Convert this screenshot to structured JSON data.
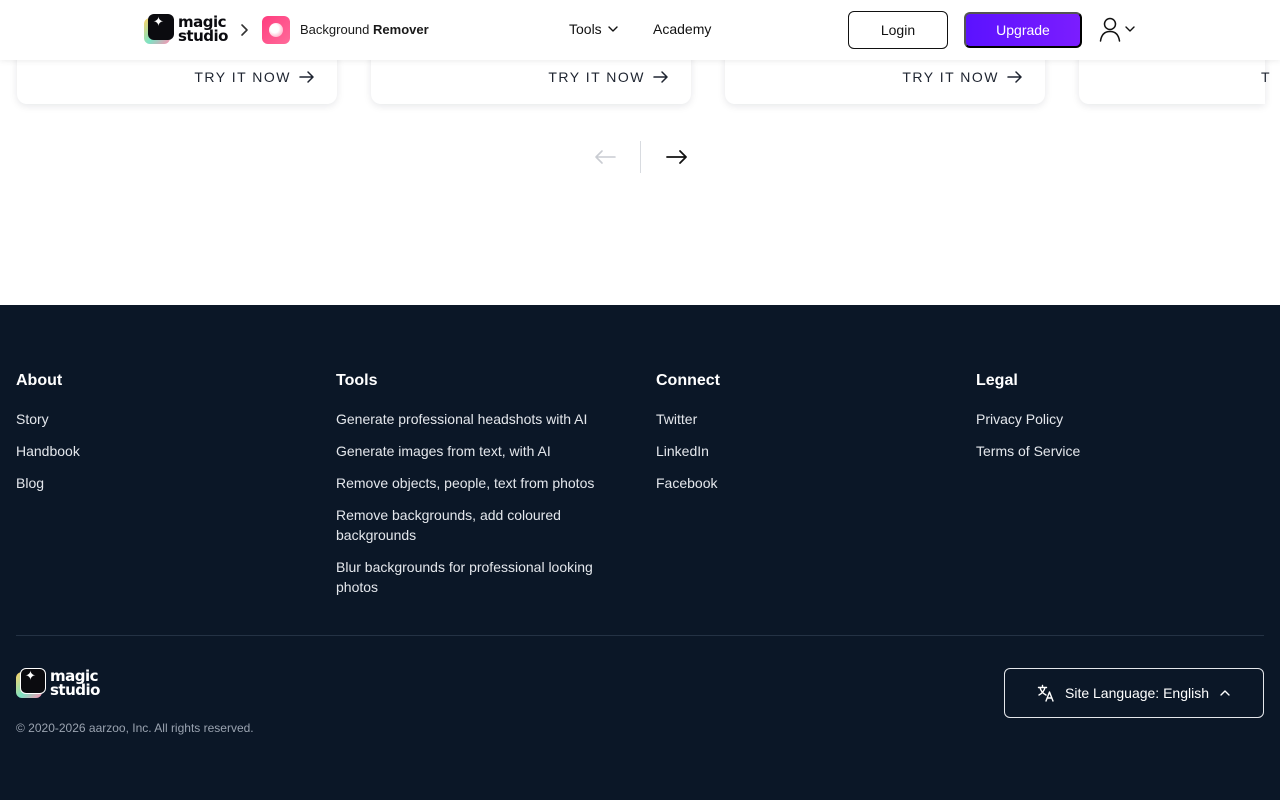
{
  "header": {
    "brand_line1": "magic",
    "brand_line2": "studio",
    "product_name_light": "Background",
    "product_name_bold": "Remover",
    "nav": {
      "tools": "Tools",
      "academy": "Academy"
    },
    "login": "Login",
    "upgrade": "Upgrade"
  },
  "cards": [
    {
      "cta": "TRY IT NOW"
    },
    {
      "cta": "TRY IT NOW"
    },
    {
      "cta": "TRY IT NOW"
    },
    {
      "cta": "T"
    }
  ],
  "footer": {
    "about": {
      "title": "About",
      "items": [
        "Story",
        "Handbook",
        "Blog"
      ]
    },
    "tools": {
      "title": "Tools",
      "items": [
        "Generate professional headshots with AI",
        "Generate images from text, with AI",
        "Remove objects, people, text from photos",
        "Remove backgrounds, add coloured backgrounds",
        "Blur backgrounds for professional looking photos"
      ]
    },
    "connect": {
      "title": "Connect",
      "items": [
        "Twitter",
        "LinkedIn",
        "Facebook"
      ]
    },
    "legal": {
      "title": "Legal",
      "items": [
        "Privacy Policy",
        "Terms of Service"
      ]
    },
    "copyright": "© 2020-2026 aarzoo, Inc. All rights reserved.",
    "language": "Site Language: English"
  },
  "icons": {
    "breadcrumb": "chevron-right-icon",
    "tools_menu": "chevron-down-icon",
    "account": "user-icon",
    "cta": "arrow-right-icon",
    "pager_prev": "arrow-left-icon",
    "pager_next": "arrow-right-icon",
    "language": "translate-icon",
    "language_toggle": "chevron-up-icon"
  },
  "colors": {
    "accent": "#5b12ff",
    "footer_bg": "#0b1727",
    "product": "#ff3d7f"
  }
}
